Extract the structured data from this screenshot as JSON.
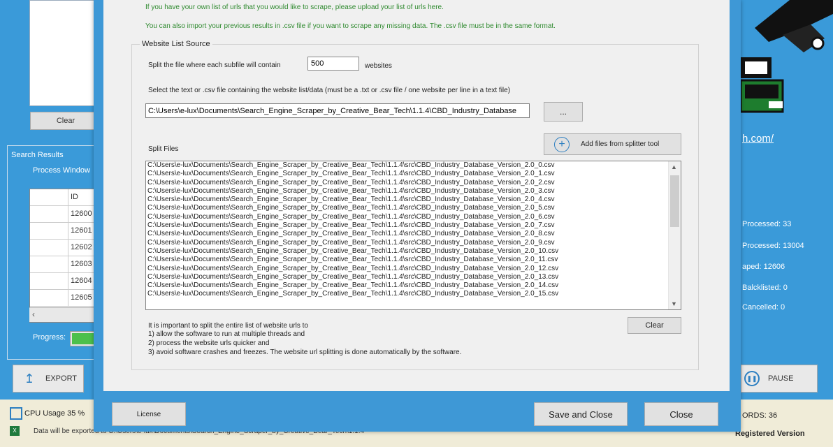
{
  "background": {
    "left": {
      "clear_label": "Clear",
      "search_results_label": "Search Results",
      "process_window_label": "Process Window",
      "table_header": "ID",
      "table_ids": [
        "12600",
        "12601",
        "12602",
        "12603",
        "12604",
        "12605"
      ],
      "progress_label": "Progress:",
      "export_label": "EXPORT"
    },
    "right": {
      "link_text": "h.com/",
      "stats": [
        "Processed: 33",
        "Processed: 13004",
        "aped: 12606",
        "Balcklisted: 0",
        "Cancelled: 0"
      ],
      "pause_label": "PAUSE"
    },
    "status": {
      "cpu_label": "CPU Usage 35 %",
      "export_message": "Data will be exported to C:\\Users\\e-lux\\Documents\\Search_Engine_Scraper_by_Creative_Bear_Tech\\1.1.4",
      "keywords_label": "ORDS: 36",
      "registered_label": "Registered Version"
    }
  },
  "dialog": {
    "info_top": "If you have your own list of urls that you would like to scrape, please upload your list of urls here.",
    "info_import": "You can also import your previous results in .csv file if you want to scrape any missing data. The .csv file must be in the same format.",
    "group_title": "Website List Source",
    "split_label": "Split the file where each subfile will contain",
    "split_value": "500",
    "split_suffix": "websites",
    "select_label": "Select the text or .csv file containing the website list/data (must be a .txt or .csv file / one website per line in a text file)",
    "path_value": "C:\\Users\\e-lux\\Documents\\Search_Engine_Scraper_by_Creative_Bear_Tech\\1.1.4\\CBD_Industry_Database",
    "browse_label": "...",
    "add_files_label": "Add files from splitter tool",
    "split_files_label": "Split Files",
    "files": [
      "C:\\Users\\e-lux\\Documents\\Search_Engine_Scraper_by_Creative_Bear_Tech\\1.1.4\\src\\CBD_Industry_Database_Version_2.0_0.csv",
      "C:\\Users\\e-lux\\Documents\\Search_Engine_Scraper_by_Creative_Bear_Tech\\1.1.4\\src\\CBD_Industry_Database_Version_2.0_1.csv",
      "C:\\Users\\e-lux\\Documents\\Search_Engine_Scraper_by_Creative_Bear_Tech\\1.1.4\\src\\CBD_Industry_Database_Version_2.0_2.csv",
      "C:\\Users\\e-lux\\Documents\\Search_Engine_Scraper_by_Creative_Bear_Tech\\1.1.4\\src\\CBD_Industry_Database_Version_2.0_3.csv",
      "C:\\Users\\e-lux\\Documents\\Search_Engine_Scraper_by_Creative_Bear_Tech\\1.1.4\\src\\CBD_Industry_Database_Version_2.0_4.csv",
      "C:\\Users\\e-lux\\Documents\\Search_Engine_Scraper_by_Creative_Bear_Tech\\1.1.4\\src\\CBD_Industry_Database_Version_2.0_5.csv",
      "C:\\Users\\e-lux\\Documents\\Search_Engine_Scraper_by_Creative_Bear_Tech\\1.1.4\\src\\CBD_Industry_Database_Version_2.0_6.csv",
      "C:\\Users\\e-lux\\Documents\\Search_Engine_Scraper_by_Creative_Bear_Tech\\1.1.4\\src\\CBD_Industry_Database_Version_2.0_7.csv",
      "C:\\Users\\e-lux\\Documents\\Search_Engine_Scraper_by_Creative_Bear_Tech\\1.1.4\\src\\CBD_Industry_Database_Version_2.0_8.csv",
      "C:\\Users\\e-lux\\Documents\\Search_Engine_Scraper_by_Creative_Bear_Tech\\1.1.4\\src\\CBD_Industry_Database_Version_2.0_9.csv",
      "C:\\Users\\e-lux\\Documents\\Search_Engine_Scraper_by_Creative_Bear_Tech\\1.1.4\\src\\CBD_Industry_Database_Version_2.0_10.csv",
      "C:\\Users\\e-lux\\Documents\\Search_Engine_Scraper_by_Creative_Bear_Tech\\1.1.4\\src\\CBD_Industry_Database_Version_2.0_11.csv",
      "C:\\Users\\e-lux\\Documents\\Search_Engine_Scraper_by_Creative_Bear_Tech\\1.1.4\\src\\CBD_Industry_Database_Version_2.0_12.csv",
      "C:\\Users\\e-lux\\Documents\\Search_Engine_Scraper_by_Creative_Bear_Tech\\1.1.4\\src\\CBD_Industry_Database_Version_2.0_13.csv",
      "C:\\Users\\e-lux\\Documents\\Search_Engine_Scraper_by_Creative_Bear_Tech\\1.1.4\\src\\CBD_Industry_Database_Version_2.0_14.csv",
      "C:\\Users\\e-lux\\Documents\\Search_Engine_Scraper_by_Creative_Bear_Tech\\1.1.4\\src\\CBD_Industry_Database_Version_2.0_15.csv"
    ],
    "note_lines": [
      "It is important to split the entire list of website urls to",
      "1) allow the software to run at multiple threads and",
      "2) process the website urls quicker and",
      "3) avoid software crashes and freezes.      The website url splitting is done automatically by the software."
    ],
    "clear_label": "Clear",
    "license_label": "License",
    "save_close_label": "Save and Close",
    "close_label": "Close"
  }
}
